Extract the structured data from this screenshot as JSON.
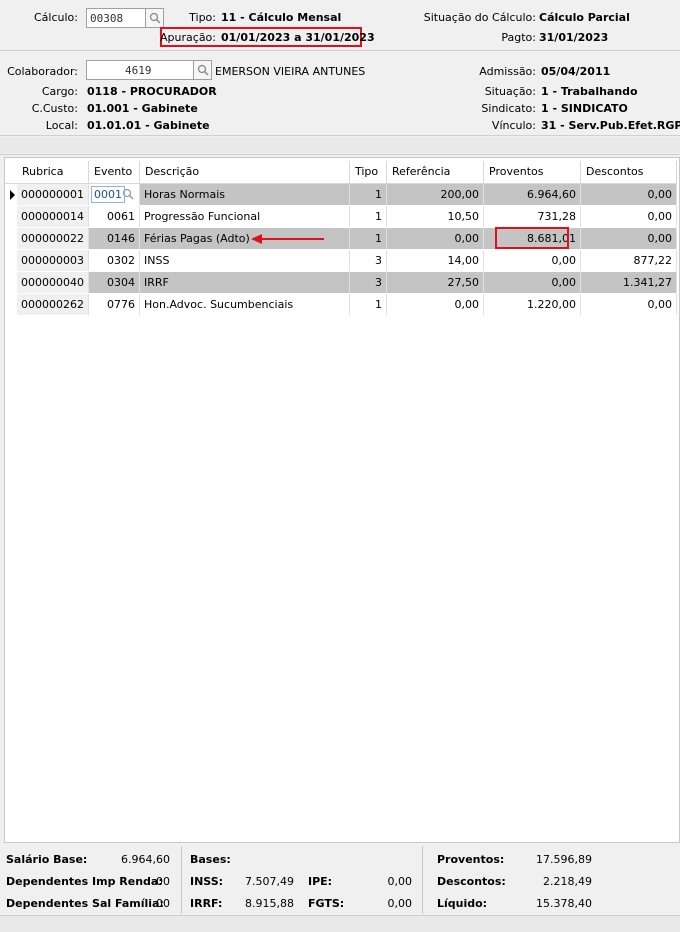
{
  "header": {
    "calculo_label": "Cálculo:",
    "calculo_value": "00308",
    "tipo_label": "Tipo:",
    "tipo_value": "11 - Cálculo Mensal",
    "apuracao_label": "Apuração:",
    "apuracao_value": "01/01/2023 a 31/01/2023",
    "situacao_calc_label": "Situação do Cálculo:",
    "situacao_calc_value": "Cálculo Parcial",
    "pagto_label": "Pagto:",
    "pagto_value": "31/01/2023"
  },
  "colaborador": {
    "label": "Colaborador:",
    "code": "4619",
    "name": "EMERSON VIEIRA ANTUNES",
    "cargo_label": "Cargo:",
    "cargo_value": "0118 - PROCURADOR",
    "ccusto_label": "C.Custo:",
    "ccusto_value": "01.001 - Gabinete",
    "local_label": "Local:",
    "local_value": "01.01.01 - Gabinete",
    "admissao_label": "Admissão:",
    "admissao_value": "05/04/2011",
    "situacao_label": "Situação:",
    "situacao_value": "1 - Trabalhando",
    "sindicato_label": "Sindicato:",
    "sindicato_value": "1 - SINDICATO",
    "vinculo_label": "Vínculo:",
    "vinculo_value": "31 - Serv.Pub.Efet.RGPS"
  },
  "grid": {
    "columns": [
      "Rubrica",
      "Evento",
      "Descrição",
      "Tipo",
      "Referência",
      "Proventos",
      "Descontos"
    ],
    "rows": [
      {
        "rubrica": "000000001",
        "evento": "0001",
        "descricao": "Horas Normais",
        "tipo": "1",
        "referencia": "200,00",
        "proventos": "6.964,60",
        "descontos": "0,00"
      },
      {
        "rubrica": "000000014",
        "evento": "0061",
        "descricao": "Progressão Funcional",
        "tipo": "1",
        "referencia": "10,50",
        "proventos": "731,28",
        "descontos": "0,00"
      },
      {
        "rubrica": "000000022",
        "evento": "0146",
        "descricao": "Férias Pagas (Adto)",
        "tipo": "1",
        "referencia": "0,00",
        "proventos": "8.681,01",
        "descontos": "0,00"
      },
      {
        "rubrica": "000000003",
        "evento": "0302",
        "descricao": "INSS",
        "tipo": "3",
        "referencia": "14,00",
        "proventos": "0,00",
        "descontos": "877,22"
      },
      {
        "rubrica": "000000040",
        "evento": "0304",
        "descricao": "IRRF",
        "tipo": "3",
        "referencia": "27,50",
        "proventos": "0,00",
        "descontos": "1.341,27"
      },
      {
        "rubrica": "000000262",
        "evento": "0776",
        "descricao": "Hon.Advoc. Sucumbenciais",
        "tipo": "1",
        "referencia": "0,00",
        "proventos": "1.220,00",
        "descontos": "0,00"
      }
    ]
  },
  "footer": {
    "salario_base_label": "Salário Base:",
    "salario_base_value": "6.964,60",
    "dep_ir_label": "Dependentes Imp Renda:",
    "dep_ir_value": "00",
    "dep_sf_label": "Dependentes Sal Família:",
    "dep_sf_value": "00",
    "bases_label": "Bases:",
    "inss_label": "INSS:",
    "inss_value": "7.507,49",
    "irrf_label": "IRRF:",
    "irrf_value": "8.915,88",
    "ipe_label": "IPE:",
    "ipe_value": "0,00",
    "fgts_label": "FGTS:",
    "fgts_value": "0,00",
    "proventos_label": "Proventos:",
    "proventos_value": "17.596,89",
    "descontos_label": "Descontos:",
    "descontos_value": "2.218,49",
    "liquido_label": "Líquido:",
    "liquido_value": "15.378,40"
  },
  "colors": {
    "highlight": "#e0101a",
    "row_shade": "#c4c4c4"
  }
}
